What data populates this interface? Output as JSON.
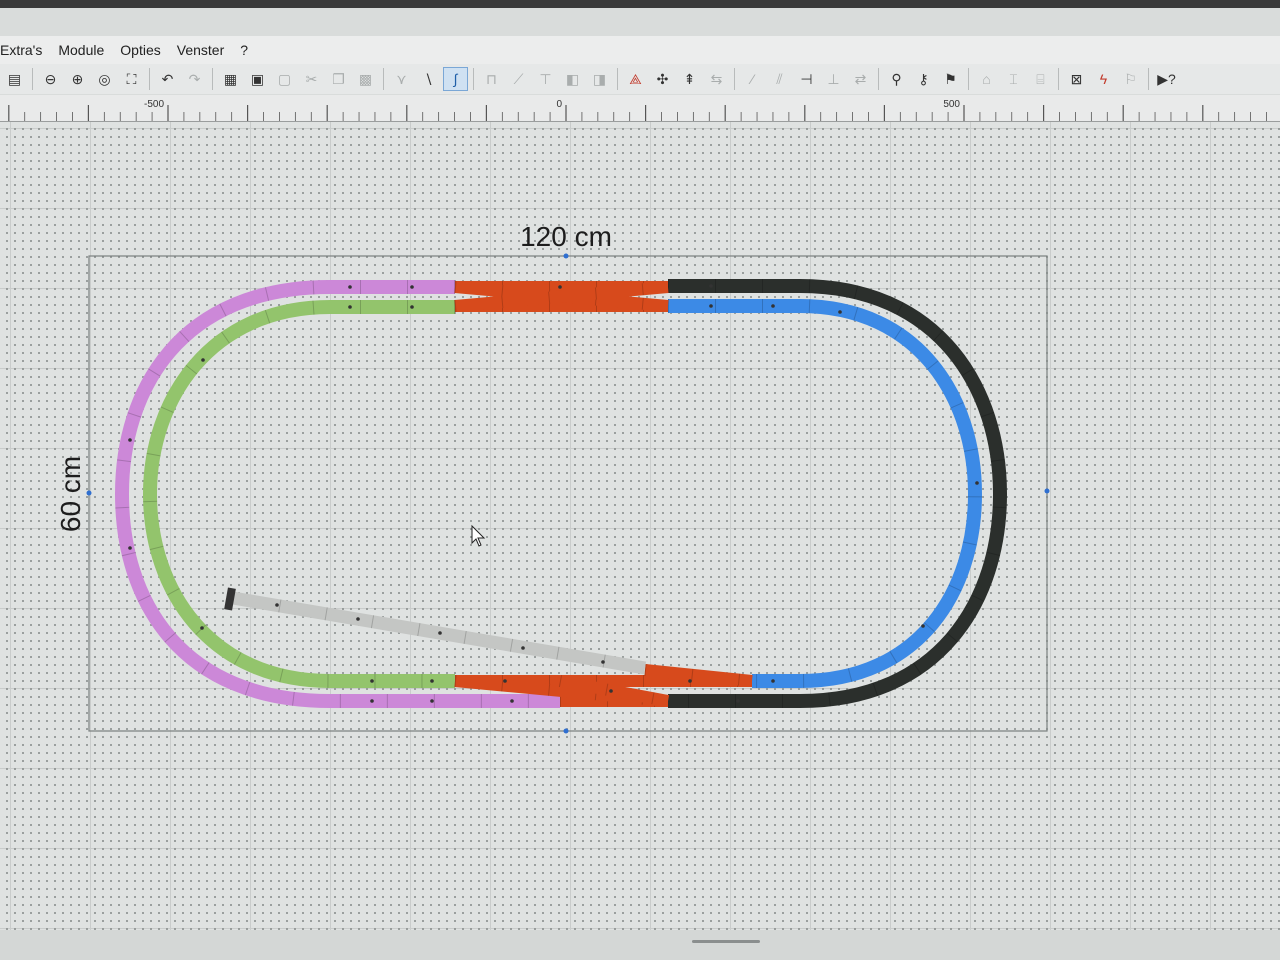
{
  "menu": {
    "items": [
      "Extra's",
      "Module",
      "Opties",
      "Venster",
      "?"
    ]
  },
  "toolbar": {
    "buttons": [
      {
        "icon": "track-save-icon",
        "glyph": "▤",
        "state": "normal"
      },
      {
        "sep": true
      },
      {
        "icon": "zoom-out-icon",
        "glyph": "⊖",
        "state": "normal"
      },
      {
        "icon": "zoom-in-icon",
        "glyph": "⊕",
        "state": "normal"
      },
      {
        "icon": "zoom-window-icon",
        "glyph": "◎",
        "state": "normal"
      },
      {
        "icon": "zoom-all-icon",
        "glyph": "⛶",
        "state": "normal"
      },
      {
        "sep": true
      },
      {
        "icon": "undo-icon",
        "glyph": "↶",
        "state": "normal"
      },
      {
        "icon": "redo-icon",
        "glyph": "↷",
        "state": "dim"
      },
      {
        "sep": true
      },
      {
        "icon": "parts-list-icon",
        "glyph": "▦",
        "state": "normal"
      },
      {
        "icon": "print-icon",
        "glyph": "▣",
        "state": "normal"
      },
      {
        "icon": "page-setup-icon",
        "glyph": "▢",
        "state": "dim"
      },
      {
        "icon": "cut-icon",
        "glyph": "✂",
        "state": "dim"
      },
      {
        "icon": "copy-icon",
        "glyph": "❐",
        "state": "dim"
      },
      {
        "icon": "paste-icon",
        "glyph": "▩",
        "state": "dim"
      },
      {
        "sep": true
      },
      {
        "icon": "switch-track-icon",
        "glyph": "⋎",
        "state": "dim"
      },
      {
        "icon": "straight-track-icon",
        "glyph": "∖",
        "state": "normal"
      },
      {
        "icon": "curve-track-icon",
        "glyph": "∫",
        "state": "active"
      },
      {
        "sep": true
      },
      {
        "icon": "ramp-icon",
        "glyph": "⊓",
        "state": "dim"
      },
      {
        "icon": "slope-icon",
        "glyph": "⟋",
        "state": "dim"
      },
      {
        "icon": "pillar-icon",
        "glyph": "⊤",
        "state": "dim"
      },
      {
        "icon": "layer-up-icon",
        "glyph": "◧",
        "state": "dim"
      },
      {
        "icon": "layer-down-icon",
        "glyph": "◨",
        "state": "dim"
      },
      {
        "sep": true
      },
      {
        "icon": "measure-icon",
        "glyph": "⟁",
        "state": "red"
      },
      {
        "icon": "connect-icon",
        "glyph": "✣",
        "state": "normal"
      },
      {
        "icon": "height-icon",
        "glyph": "⇞",
        "state": "normal"
      },
      {
        "icon": "align-icon",
        "glyph": "⇆",
        "state": "dim"
      },
      {
        "sep": true
      },
      {
        "icon": "flex-track-icon",
        "glyph": "⁄",
        "state": "dim"
      },
      {
        "icon": "split-icon",
        "glyph": "⫽",
        "state": "dim"
      },
      {
        "icon": "join-icon",
        "glyph": "⊣",
        "state": "normal"
      },
      {
        "icon": "rotate-icon",
        "glyph": "⊥",
        "state": "dim"
      },
      {
        "icon": "mirror-icon",
        "glyph": "⇄",
        "state": "dim"
      },
      {
        "sep": true
      },
      {
        "icon": "find-part-icon",
        "glyph": "⚲",
        "state": "normal"
      },
      {
        "icon": "find-group-icon",
        "glyph": "⚷",
        "state": "normal"
      },
      {
        "icon": "search-help-icon",
        "glyph": "⚑",
        "state": "normal"
      },
      {
        "sep": true
      },
      {
        "icon": "level-icon",
        "glyph": "⌂",
        "state": "dim"
      },
      {
        "icon": "level2-icon",
        "glyph": "⌶",
        "state": "dim"
      },
      {
        "icon": "level3-icon",
        "glyph": "⌸",
        "state": "dim"
      },
      {
        "sep": true
      },
      {
        "icon": "center-icon",
        "glyph": "⊠",
        "state": "normal"
      },
      {
        "icon": "electric-icon",
        "glyph": "ϟ",
        "state": "red"
      },
      {
        "icon": "signal-icon",
        "glyph": "⚐",
        "state": "dim"
      },
      {
        "sep": true
      },
      {
        "icon": "help-cursor-icon",
        "glyph": "▶?",
        "state": "normal"
      }
    ]
  },
  "ruler": {
    "labels": [
      {
        "text": "-500",
        "value": -500
      },
      {
        "text": "0",
        "value": 0
      },
      {
        "text": "500",
        "value": 500
      }
    ]
  },
  "board": {
    "width_label": "120 cm",
    "height_label": "60 cm"
  },
  "track_colors": {
    "violet": "#cc88d8",
    "green": "#93c46c",
    "orange": "#d74a1c",
    "blue": "#3c8ae6",
    "black": "#2b2f2c",
    "grey": "#c4c6c4"
  }
}
